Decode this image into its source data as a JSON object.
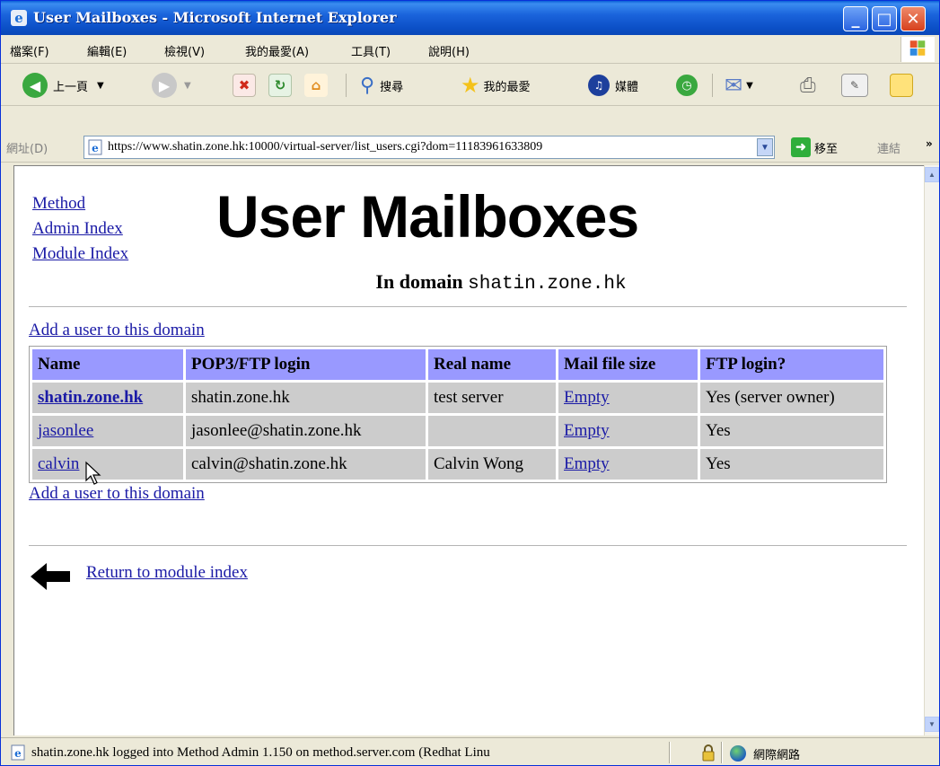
{
  "window": {
    "title": "User Mailboxes - Microsoft Internet Explorer",
    "min_glyph": "_",
    "max_glyph": "□",
    "close_glyph": "✕"
  },
  "menu": [
    "檔案(F)",
    "編輯(E)",
    "檢視(V)",
    "我的最愛(A)",
    "工具(T)",
    "說明(H)"
  ],
  "toolbar": {
    "back": "上一頁",
    "search": "搜尋",
    "favorites": "我的最愛",
    "media": "媒體"
  },
  "address": {
    "label": "網址(D)",
    "url": "https://www.shatin.zone.hk:10000/virtual-server/list_users.cgi?dom=11183961633809",
    "go": "移至",
    "links": "連結"
  },
  "page": {
    "nav_links": [
      "Method",
      "Admin Index",
      "Module Index"
    ],
    "title": "User Mailboxes",
    "subtitle_prefix": "In domain",
    "domain": "shatin.zone.hk",
    "add_user_top": "Add a user to this domain",
    "add_user_bottom": "Add a user to this domain",
    "table": {
      "headers": [
        "Name",
        "POP3/FTP login",
        "Real name",
        "Mail file size",
        "FTP login?"
      ],
      "rows": [
        {
          "name": "shatin.zone.hk",
          "login": "shatin.zone.hk",
          "real_name": "test server",
          "mail_size": "Empty",
          "ftp": "Yes (server owner)"
        },
        {
          "name": "jasonlee",
          "login": "jasonlee@shatin.zone.hk",
          "real_name": "",
          "mail_size": "Empty",
          "ftp": "Yes"
        },
        {
          "name": "calvin",
          "login": "calvin@shatin.zone.hk",
          "real_name": "Calvin Wong",
          "mail_size": "Empty",
          "ftp": "Yes"
        }
      ]
    },
    "return_link": "Return to module index"
  },
  "status": {
    "text": "shatin.zone.hk logged into Method Admin 1.150 on method.server.com (Redhat Linu",
    "zone": "網際網路"
  },
  "colors": {
    "table_header": "#9999ff",
    "table_cell": "#cccccc",
    "link": "#1a1aa6",
    "titlebar": "#0b4fc6"
  }
}
